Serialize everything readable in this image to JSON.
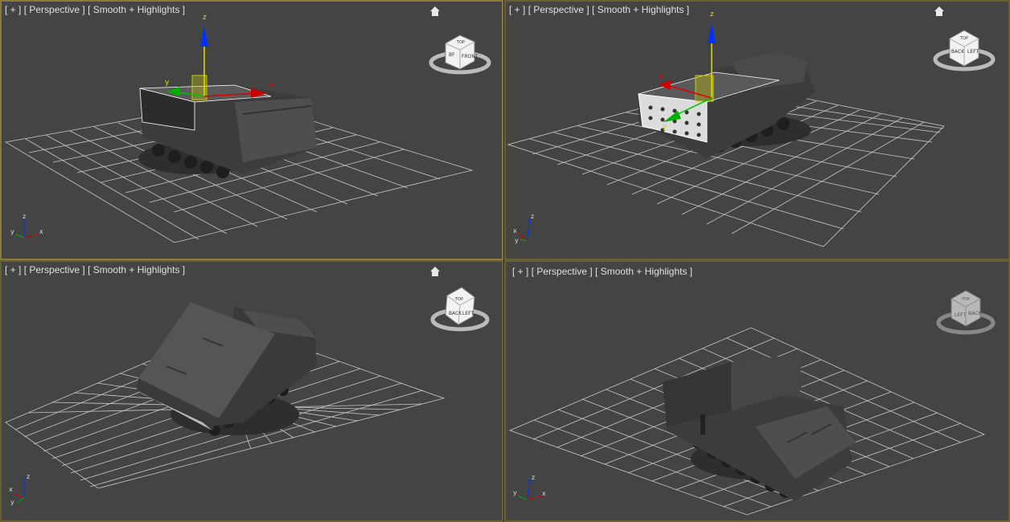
{
  "viewports": [
    {
      "plus": "[ + ]",
      "view": "[ Perspective ]",
      "shading": "[ Smooth + Highlights ]",
      "cube_faces": [
        "BF",
        "FRONT",
        "TOP"
      ],
      "active": true
    },
    {
      "plus": "[ + ]",
      "view": "[ Perspective ]",
      "shading": "[ Smooth + Highlights ]",
      "cube_faces": [
        "BACK",
        "LEFT",
        "TOP"
      ],
      "active": false
    },
    {
      "plus": "[ + ]",
      "view": "[ Perspective ]",
      "shading": "[ Smooth + Highlights ]",
      "cube_faces": [
        "BACK",
        "LEFT",
        "TOP"
      ],
      "active": false
    },
    {
      "plus": "[ + ]",
      "view": "[ Perspective ]",
      "shading": "[ Smooth + Highlights ]",
      "cube_faces": [
        "LEFT",
        "BACK",
        "TOP"
      ],
      "active": false
    }
  ],
  "gizmo": {
    "x": "x",
    "y": "y",
    "z": "z"
  },
  "tripod": {
    "x": "x",
    "y": "y",
    "z": "z"
  },
  "colors": {
    "viewport_bg": "#444444",
    "grid": "#c8c8c8",
    "border_active": "#8a7a3a",
    "label": "#e0e0e0",
    "axis_x": "#d00000",
    "axis_y": "#00b000",
    "axis_z": "#0030ff",
    "gizmo_plane": "#c8c800"
  }
}
